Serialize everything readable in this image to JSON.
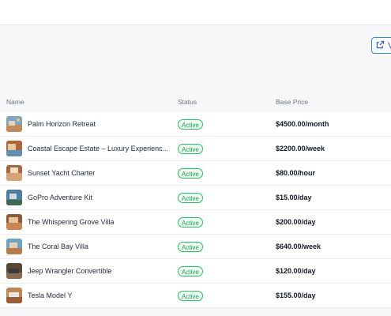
{
  "toolbar": {
    "view_button_label": "V"
  },
  "table": {
    "headers": {
      "name": "Name",
      "status": "Status",
      "base_price": "Base Price"
    },
    "rows": [
      {
        "name": "Palm Horizon Retreat",
        "status": "Active",
        "price": "$4500.00/month"
      },
      {
        "name": "Coastal Escape Estate – Luxury Experienc...",
        "status": "Active",
        "price": "$2200.00/week"
      },
      {
        "name": "Sunset Yacht Charter",
        "status": "Active",
        "price": "$80.00/hour"
      },
      {
        "name": "GoPro Adventure Kit",
        "status": "Active",
        "price": "$15.00/day"
      },
      {
        "name": "The Whispering Grove Villa",
        "status": "Active",
        "price": "$200.00/day"
      },
      {
        "name": "The Coral Bay Villa",
        "status": "Active",
        "price": "$640.00/week"
      },
      {
        "name": "Jeep Wrangler Convertible",
        "status": "Active",
        "price": "$120.00/day"
      },
      {
        "name": "Tesla Model Y",
        "status": "Active",
        "price": "$155.00/day"
      }
    ]
  },
  "colors": {
    "accent": "#3b82f6",
    "status_active": "#16a34a",
    "status_active_bg": "#f0fdf4"
  },
  "icons": {
    "view_button": "external-link-icon"
  }
}
